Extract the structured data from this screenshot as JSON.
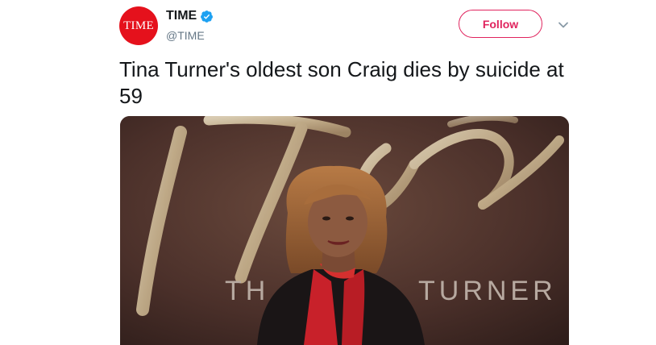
{
  "account": {
    "avatar_text": "TIME",
    "display_name": "TIME",
    "handle": "@TIME",
    "verified": true,
    "brand_color": "#e5111c"
  },
  "actions": {
    "follow_label": "Follow",
    "follow_color": "#e0245e",
    "menu_icon": "chevron-down-icon"
  },
  "tweet": {
    "text": "Tina Turner's oldest son Craig dies by suicide at 59"
  },
  "media": {
    "backdrop_text_left": "TH",
    "backdrop_text_right": "TURNER"
  }
}
